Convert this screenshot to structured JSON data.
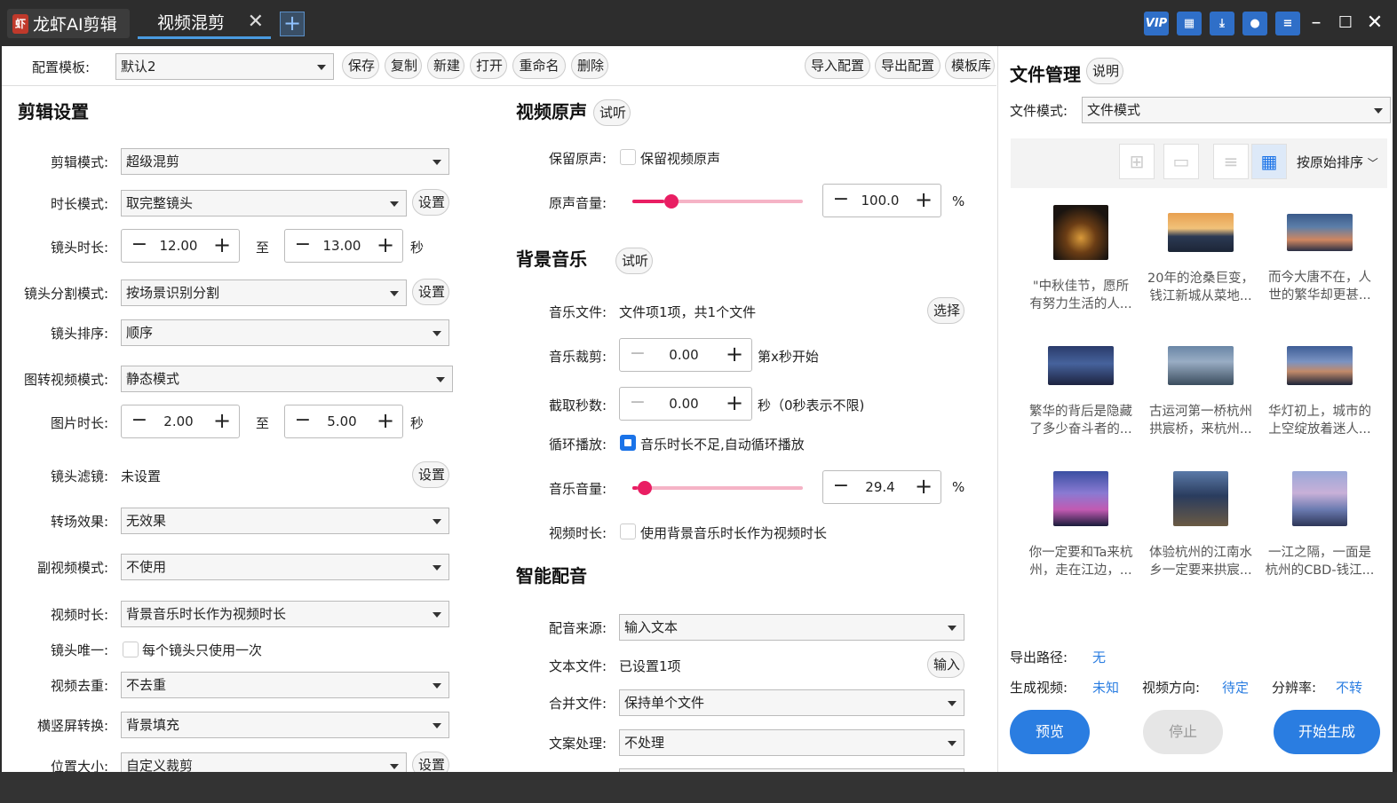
{
  "titlebar": {
    "app_name": "龙虾AI剪辑",
    "tab": "视频混剪",
    "add_tab": "+",
    "vip": "VIP"
  },
  "config": {
    "label": "配置模板:",
    "value": "默认2",
    "save": "保存",
    "copy": "复制",
    "new": "新建",
    "open": "打开",
    "rename": "重命名",
    "delete": "删除",
    "import": "导入配置",
    "export": "导出配置",
    "library": "模板库"
  },
  "edit": {
    "title": "剪辑设置",
    "mode_label": "剪辑模式:",
    "mode_value": "超级混剪",
    "duration_mode_label": "时长模式:",
    "duration_mode_value": "取完整镜头",
    "duration_mode_btn": "设置",
    "shot_len_label": "镜头时长:",
    "shot_len_min": "12.00",
    "shot_len_max": "13.00",
    "to": "至",
    "sec": "秒",
    "split_label": "镜头分割模式:",
    "split_value": "按场景识别分割",
    "split_btn": "设置",
    "order_label": "镜头排序:",
    "order_value": "顺序",
    "img2video_label": "图转视频模式:",
    "img2video_value": "静态模式",
    "img_len_label": "图片时长:",
    "img_len_min": "2.00",
    "img_len_max": "5.00",
    "filter_label": "镜头滤镜:",
    "filter_value": "未设置",
    "filter_btn": "设置",
    "transition_label": "转场效果:",
    "transition_value": "无效果",
    "subvideo_label": "副视频模式:",
    "subvideo_value": "不使用",
    "video_len_label": "视频时长:",
    "video_len_value": "背景音乐时长作为视频时长",
    "unique_label": "镜头唯一:",
    "unique_text": "每个镜头只使用一次",
    "dedupe_label": "视频去重:",
    "dedupe_value": "不去重",
    "orient_label": "横竖屏转换:",
    "orient_value": "背景填充",
    "pos_label": "位置大小:",
    "pos_value": "自定义裁剪",
    "pos_btn": "设置"
  },
  "original_audio": {
    "title": "视频原声",
    "listen": "试听",
    "keep_label": "保留原声:",
    "keep_text": "保留视频原声",
    "volume_label": "原声音量:",
    "volume_value": "100.0",
    "volume_fraction": 0.19,
    "percent": "%"
  },
  "bgm": {
    "title": "背景音乐",
    "listen": "试听",
    "file_label": "音乐文件:",
    "file_value": "文件项1项，共1个文件",
    "file_btn": "选择",
    "trim_label": "音乐裁剪:",
    "trim_value": "0.00",
    "trim_suffix": "第x秒开始",
    "cut_label": "截取秒数:",
    "cut_value": "0.00",
    "cut_suffix": "秒（0秒表示不限)",
    "loop_label": "循环播放:",
    "loop_text": "音乐时长不足,自动循环播放",
    "volume_label": "音乐音量:",
    "volume_value": "29.4",
    "volume_fraction": 0.03,
    "percent": "%",
    "vlen_label": "视频时长:",
    "vlen_text": "使用背景音乐时长作为视频时长"
  },
  "dubbing": {
    "title": "智能配音",
    "source_label": "配音来源:",
    "source_value": "输入文本",
    "text_label": "文本文件:",
    "text_value": "已设置1项",
    "text_btn": "输入",
    "merge_label": "合并文件:",
    "merge_value": "保持单个文件",
    "process_label": "文案处理:",
    "process_value": "不处理"
  },
  "files": {
    "title": "文件管理",
    "help": "说明",
    "mode_label": "文件模式:",
    "mode_value": "文件模式",
    "sort": "按原始排序",
    "items": [
      {
        "line1": "\"中秋佳节，愿所",
        "line2": "有努力生活的人..."
      },
      {
        "line1": "20年的沧桑巨变，",
        "line2": "钱江新城从菜地..."
      },
      {
        "line1": "而今大唐不在，人",
        "line2": "世的繁华却更甚..."
      },
      {
        "line1": "繁华的背后是隐藏",
        "line2": "了多少奋斗者的..."
      },
      {
        "line1": "古运河第一桥杭州",
        "line2": "拱宸桥，来杭州..."
      },
      {
        "line1": "华灯初上，城市的",
        "line2": "上空绽放着迷人..."
      },
      {
        "line1": "你一定要和Ta来杭",
        "line2": "州，走在江边，..."
      },
      {
        "line1": "体验杭州的江南水",
        "line2": "乡一定要来拱宸..."
      },
      {
        "line1": "一江之隔，一面是",
        "line2": "杭州的CBD-钱江..."
      }
    ],
    "export_label": "导出路径:",
    "export_value": "无",
    "gen_label": "生成视频:",
    "gen_value": "未知",
    "dir_label": "视频方向:",
    "dir_value": "待定",
    "res_label": "分辨率:",
    "res_value": "不转",
    "preview": "预览",
    "stop": "停止",
    "start": "开始生成"
  },
  "colors": {
    "accent": "#2a7de1",
    "slider": "#e91e63",
    "titlebar": "#2d2d2d"
  }
}
